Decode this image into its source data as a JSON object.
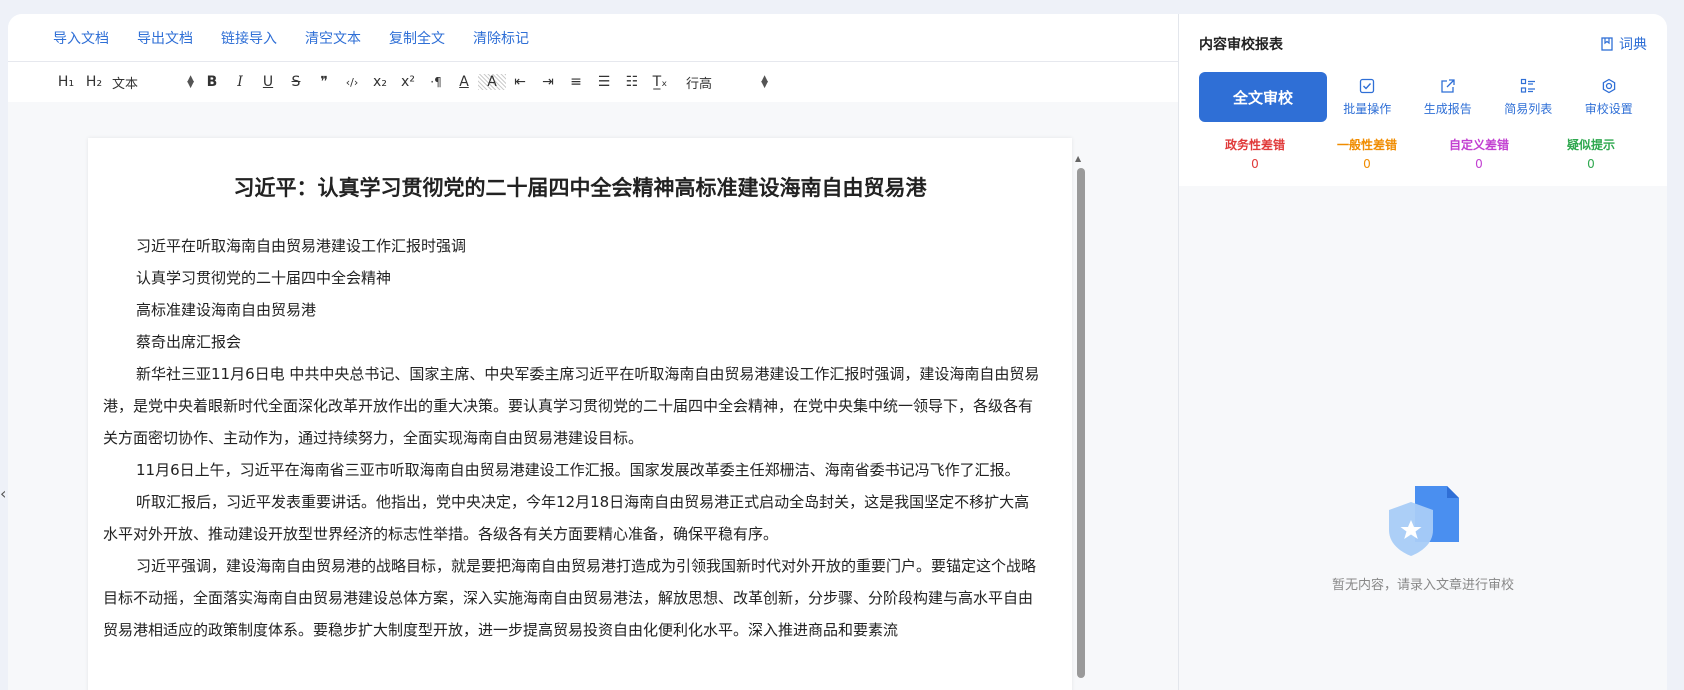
{
  "menu": [
    "导入文档",
    "导出文档",
    "链接导入",
    "清空文本",
    "复制全文",
    "清除标记"
  ],
  "toolbar": {
    "h1": "H₁",
    "h2": "H₂",
    "format_select": "文本",
    "bold": "B",
    "italic": "I",
    "underline": "U",
    "strike": "S",
    "quote": "❞",
    "code": "‹/›",
    "sub": "x₂",
    "sup": "x²",
    "direction": "·¶",
    "color": "A",
    "bg": "A",
    "outdent": "⇤",
    "indent": "⇥",
    "align": "≡",
    "bullet": "☰",
    "ordered": "☷",
    "clear": "T̲ₓ",
    "lineheight_select": "行高"
  },
  "document": {
    "title": "习近平：认真学习贯彻党的二十届四中全会精神高标准建设海南自由贸易港",
    "paragraphs": [
      "习近平在听取海南自由贸易港建设工作汇报时强调",
      "认真学习贯彻党的二十届四中全会精神",
      "高标准建设海南自由贸易港",
      "蔡奇出席汇报会",
      "新华社三亚11月6日电 中共中央总书记、国家主席、中央军委主席习近平在听取海南自由贸易港建设工作汇报时强调，建设海南自由贸易港，是党中央着眼新时代全面深化改革开放作出的重大决策。要认真学习贯彻党的二十届四中全会精神，在党中央集中统一领导下，各级各有关方面密切协作、主动作为，通过持续努力，全面实现海南自由贸易港建设目标。",
      "11月6日上午，习近平在海南省三亚市听取海南自由贸易港建设工作汇报。国家发展改革委主任郑栅洁、海南省委书记冯飞作了汇报。",
      "听取汇报后，习近平发表重要讲话。他指出，党中央决定，今年12月18日海南自由贸易港正式启动全岛封关，这是我国坚定不移扩大高水平对外开放、推动建设开放型世界经济的标志性举措。各级各有关方面要精心准备，确保平稳有序。",
      "习近平强调，建设海南自由贸易港的战略目标，就是要把海南自由贸易港打造成为引领我国新时代对外开放的重要门户。要锚定这个战略目标不动摇，全面落实海南自由贸易港建设总体方案，深入实施海南自由贸易港法，解放思想、改革创新，分步骤、分阶段构建与高水平自由贸易港相适应的政策制度体系。要稳步扩大制度型开放，进一步提高贸易投资自由化便利化水平。深入推进商品和要素流"
    ]
  },
  "report": {
    "title": "内容审校报表",
    "dict_label": "词典",
    "primary_button": "全文审校",
    "actions": [
      "批量操作",
      "生成报告",
      "简易列表",
      "审校设置"
    ],
    "stats": [
      {
        "name": "政务性差错",
        "count": "0",
        "color": "#e03a3a"
      },
      {
        "name": "一般性差错",
        "count": "0",
        "color": "#f08c00"
      },
      {
        "name": "自定义差错",
        "count": "0",
        "color": "#c23fd1"
      },
      {
        "name": "疑似提示",
        "count": "0",
        "color": "#2fa84f"
      }
    ],
    "empty_text": "暂无内容，请录入文章进行审校"
  }
}
